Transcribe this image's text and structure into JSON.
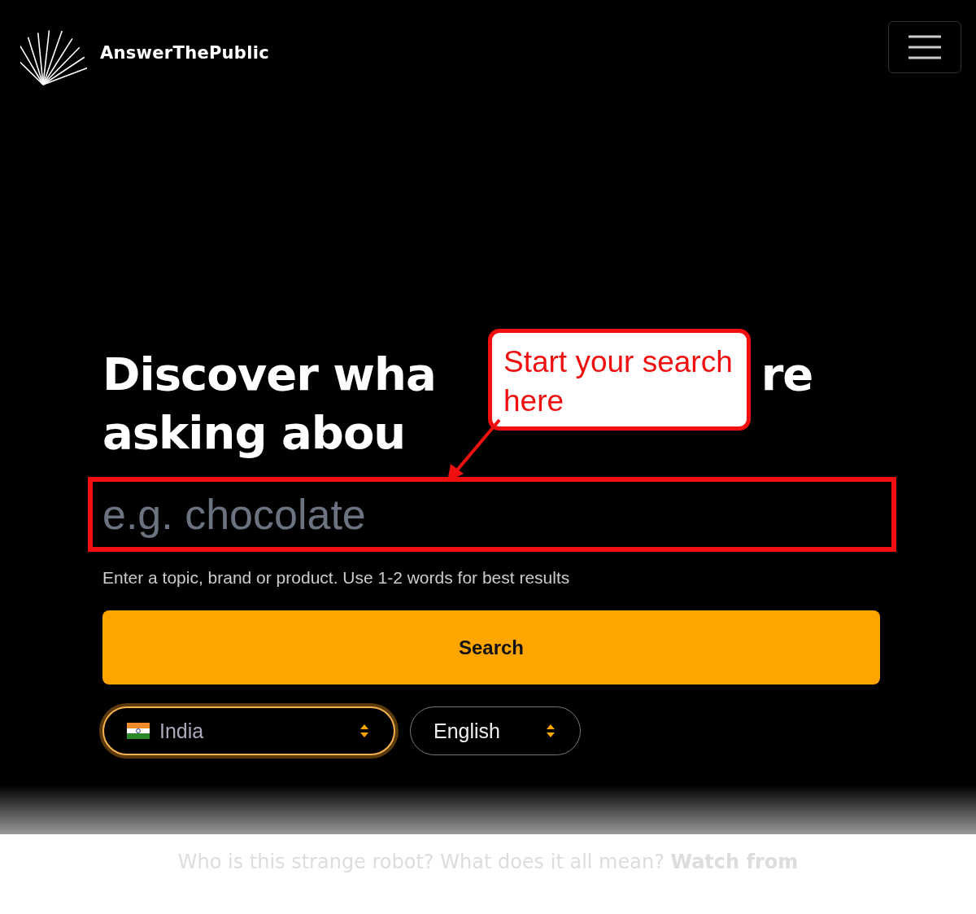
{
  "header": {
    "logo_text": "AnswerThePublic",
    "menu_button": true
  },
  "hero": {
    "headline_line_1": [
      "Discover wha",
      "re"
    ],
    "headline_line_2": "asking abou",
    "callout": {
      "text": "Start your search here"
    },
    "search": {
      "placeholder": "e.g. chocolate",
      "highlighted": true
    },
    "hint": "Enter a topic, brand or product. Use 1-2 words for best results",
    "button": "Search",
    "selects": [
      {
        "kind": "country",
        "label": "India",
        "focused": true
      },
      {
        "kind": "language",
        "label": "English",
        "focused": false
      }
    ]
  },
  "footer_text": "Who is this strange robot? What does it all mean? **Watch from**"
}
